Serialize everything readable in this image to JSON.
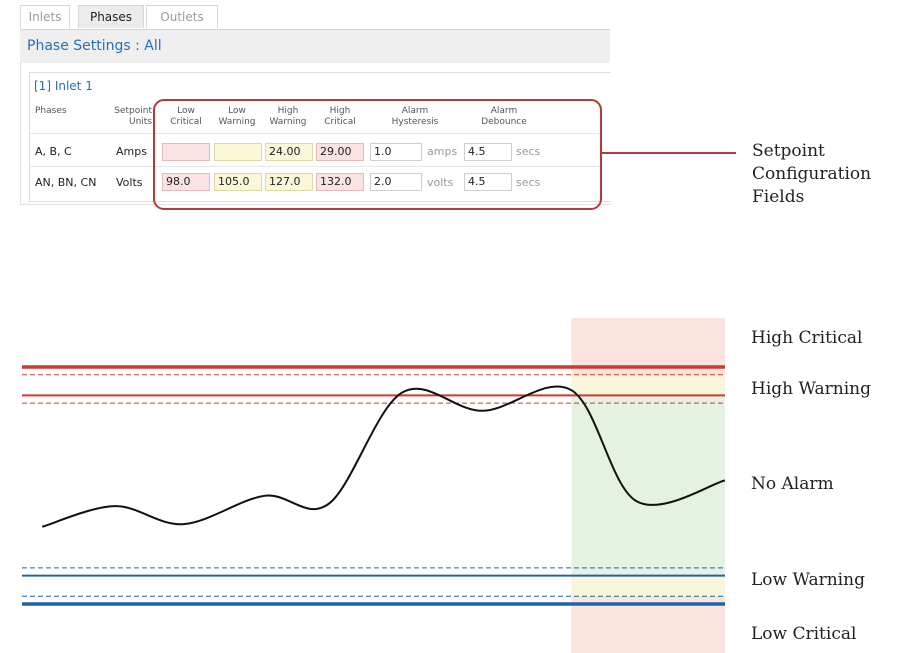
{
  "tabs": [
    {
      "label": "Inlets",
      "active": false
    },
    {
      "label": "Phases",
      "active": true
    },
    {
      "label": "Outlets",
      "active": false
    }
  ],
  "settings_title": "Phase Settings : All",
  "inlet_title": "[1] Inlet 1",
  "columns": {
    "phases": "Phases",
    "units": [
      "Setpoint",
      "Units"
    ],
    "low_critical": [
      "Low",
      "Critical"
    ],
    "low_warning": [
      "Low",
      "Warning"
    ],
    "high_warning": [
      "High",
      "Warning"
    ],
    "high_critical": [
      "High",
      "Critical"
    ],
    "hysteresis": [
      "Alarm",
      "Hysteresis"
    ],
    "debounce": [
      "Alarm",
      "Debounce"
    ]
  },
  "rows": [
    {
      "phases": "A, B, C",
      "units": "Amps",
      "low_critical": "",
      "low_warning": "",
      "high_warning": "24.00",
      "high_critical": "29.00",
      "hysteresis": "1.0",
      "hysteresis_unit": "amps",
      "debounce": "4.5",
      "debounce_unit": "secs"
    },
    {
      "phases": "AN, BN, CN",
      "units": "Volts",
      "low_critical": "98.0",
      "low_warning": "105.0",
      "high_warning": "127.0",
      "high_critical": "132.0",
      "hysteresis": "2.0",
      "hysteresis_unit": "volts",
      "debounce": "4.5",
      "debounce_unit": "secs"
    }
  ],
  "callout_label": [
    "Setpoint",
    "Configuration",
    "Fields"
  ],
  "zone_labels": {
    "high_critical": "High Critical",
    "high_warning": "High Warning",
    "no_alarm": "No Alarm",
    "low_warning": "Low Warning",
    "low_critical": "Low Critical"
  },
  "colors": {
    "accent": "#2a6fb5",
    "callout": "#b43a3a",
    "critical_fill": "#fbe3e3",
    "warning_fill": "#fbf7d9",
    "high_line": "#cc3a32",
    "low_line": "#1f64a6",
    "ok_zone": "#e5f1e1",
    "warn_zone": "#f9f6d9",
    "crit_zone": "#fbe4dd"
  },
  "chart_data": {
    "type": "line",
    "title": "",
    "xlabel": "",
    "ylabel": "",
    "ylim": [
      0,
      10
    ],
    "thresholds": [
      {
        "name": "High Critical",
        "value": 9.2,
        "style": "solid-thick",
        "color": "#cc3a32",
        "tolerance_value": 8.9
      },
      {
        "name": "High Warning",
        "value": 8.1,
        "style": "solid",
        "color": "#cc3a32",
        "tolerance_value": 7.8
      },
      {
        "name": "Low Warning",
        "value": 1.1,
        "style": "solid",
        "color": "#1f64a6",
        "tolerance_value": 1.4
      },
      {
        "name": "Low Critical",
        "value": 0.0,
        "style": "solid-thick",
        "color": "#1f64a6",
        "tolerance_value": 0.3
      }
    ],
    "shaded_x_range": [
      13.6,
      17.4
    ],
    "series": [
      {
        "x": [
          0.5,
          2.3,
          4.0,
          6.0,
          7.6,
          9.4,
          11.4,
          13.6,
          15.2,
          17.4
        ],
        "values": [
          3.0,
          3.8,
          3.1,
          4.2,
          3.9,
          8.2,
          7.5,
          8.3,
          4.0,
          4.8
        ]
      }
    ],
    "xlim": [
      0,
      17.4
    ]
  }
}
